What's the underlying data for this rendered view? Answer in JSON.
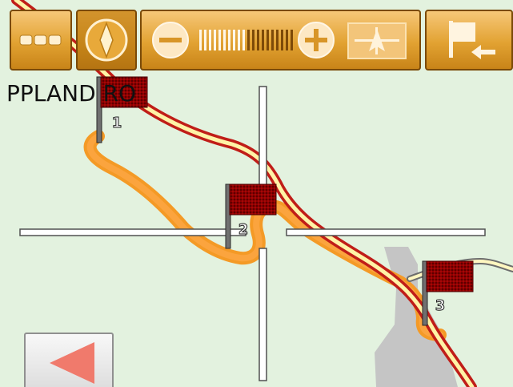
{
  "toolbar": {
    "buttons": [
      {
        "icon": "menu-dots-icon"
      },
      {
        "icon": "compass-icon",
        "state": "pressed"
      },
      {
        "icon": "zoom-out-icon"
      },
      {
        "icon": "zoom-level-slider",
        "level": 0.5
      },
      {
        "icon": "zoom-in-icon"
      },
      {
        "icon": "north-up-icon"
      },
      {
        "icon": "flag-return-icon"
      }
    ]
  },
  "map": {
    "place_label": "PPLAND  RO",
    "waypoints": [
      {
        "number": "1"
      },
      {
        "number": "2"
      },
      {
        "number": "3"
      }
    ]
  },
  "back_button": {
    "icon": "back-arrow-icon"
  },
  "colors": {
    "map_background": "#e3f2df",
    "toolbar_button": "#e2a232",
    "route_halo": "#f49a26",
    "road_fill": "#fff3a6",
    "road_border": "#c01d18",
    "flag_red": "#8e0000",
    "back_arrow": "#f07a6c",
    "gray_area": "#c5c5c5"
  }
}
